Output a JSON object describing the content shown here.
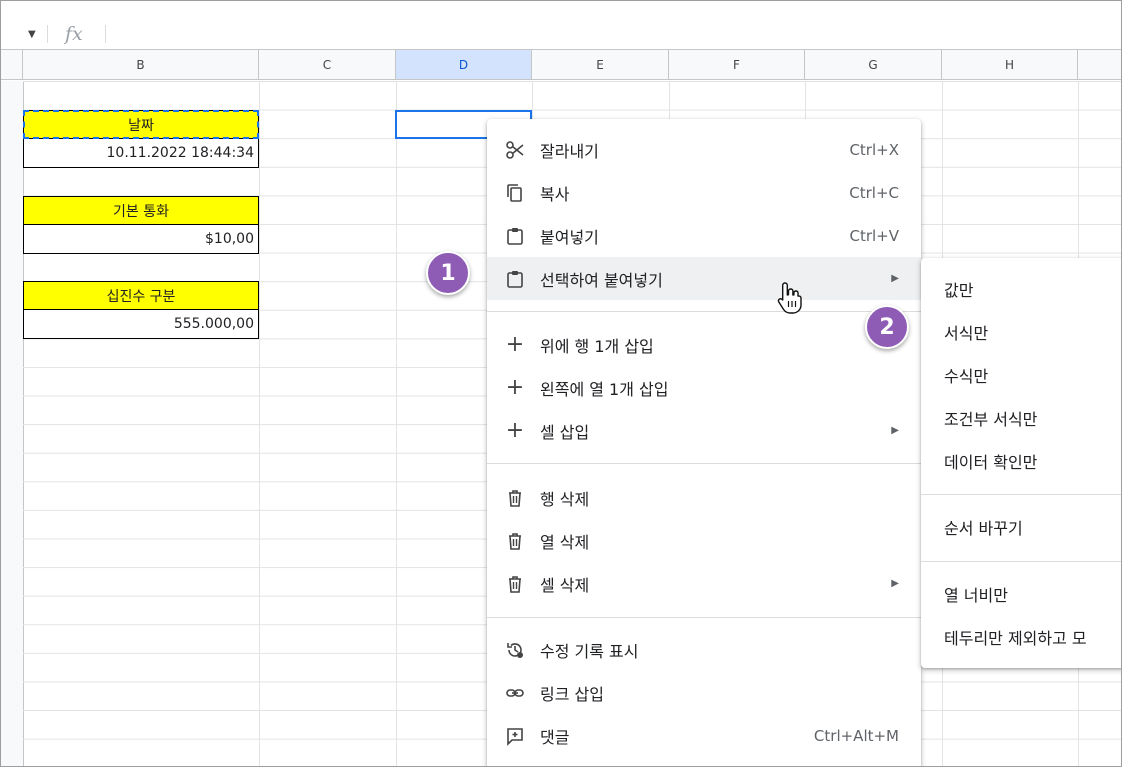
{
  "formula_bar": {
    "fx_label": "fx"
  },
  "columns": [
    {
      "label": "B",
      "selected": false
    },
    {
      "label": "C",
      "selected": false
    },
    {
      "label": "D",
      "selected": true
    },
    {
      "label": "E",
      "selected": false
    },
    {
      "label": "F",
      "selected": false
    },
    {
      "label": "G",
      "selected": false
    },
    {
      "label": "H",
      "selected": false
    }
  ],
  "cells": {
    "date_label": "날짜",
    "date_value": "10.11.2022 18:44:34",
    "currency_label": "기본 통화",
    "currency_value": "$10,00",
    "decimal_label": "십진수 구분",
    "decimal_value": "555.000,00"
  },
  "context_menu": {
    "cut": {
      "label": "잘라내기",
      "shortcut": "Ctrl+X",
      "icon": "scissors-icon"
    },
    "copy": {
      "label": "복사",
      "shortcut": "Ctrl+C",
      "icon": "copy-icon"
    },
    "paste": {
      "label": "붙여넣기",
      "shortcut": "Ctrl+V",
      "icon": "clipboard-icon"
    },
    "paste_special": {
      "label": "선택하여 붙여넣기",
      "icon": "clipboard-icon",
      "highlighted": true
    },
    "insert_row_above": {
      "label": "위에 행 1개 삽입",
      "icon": "plus-icon"
    },
    "insert_col_left": {
      "label": "왼쪽에 열 1개 삽입",
      "icon": "plus-icon"
    },
    "insert_cells": {
      "label": "셀 삽입",
      "icon": "plus-icon"
    },
    "delete_row": {
      "label": "행 삭제",
      "icon": "trash-icon"
    },
    "delete_col": {
      "label": "열 삭제",
      "icon": "trash-icon"
    },
    "delete_cells": {
      "label": "셀 삭제",
      "icon": "trash-icon"
    },
    "edit_history": {
      "label": "수정 기록 표시",
      "icon": "history-icon"
    },
    "insert_link": {
      "label": "링크 삽입",
      "icon": "link-icon"
    },
    "comment": {
      "label": "댓글",
      "shortcut": "Ctrl+Alt+M",
      "icon": "comment-icon"
    }
  },
  "submenu": {
    "values_only": "값만",
    "format_only": "서식만",
    "formula_only": "수식만",
    "conditional_format_only": "조건부 서식만",
    "data_validation_only": "데이터 확인만",
    "transpose": "순서 바꾸기",
    "column_width_only": "열 너비만",
    "all_except_borders": "테두리만 제외하고 모"
  },
  "badges": {
    "first": "1",
    "second": "2"
  },
  "colors": {
    "badge": "#8e5bb5",
    "label_fill": "#ffff00",
    "selection": "#1a73e8"
  }
}
